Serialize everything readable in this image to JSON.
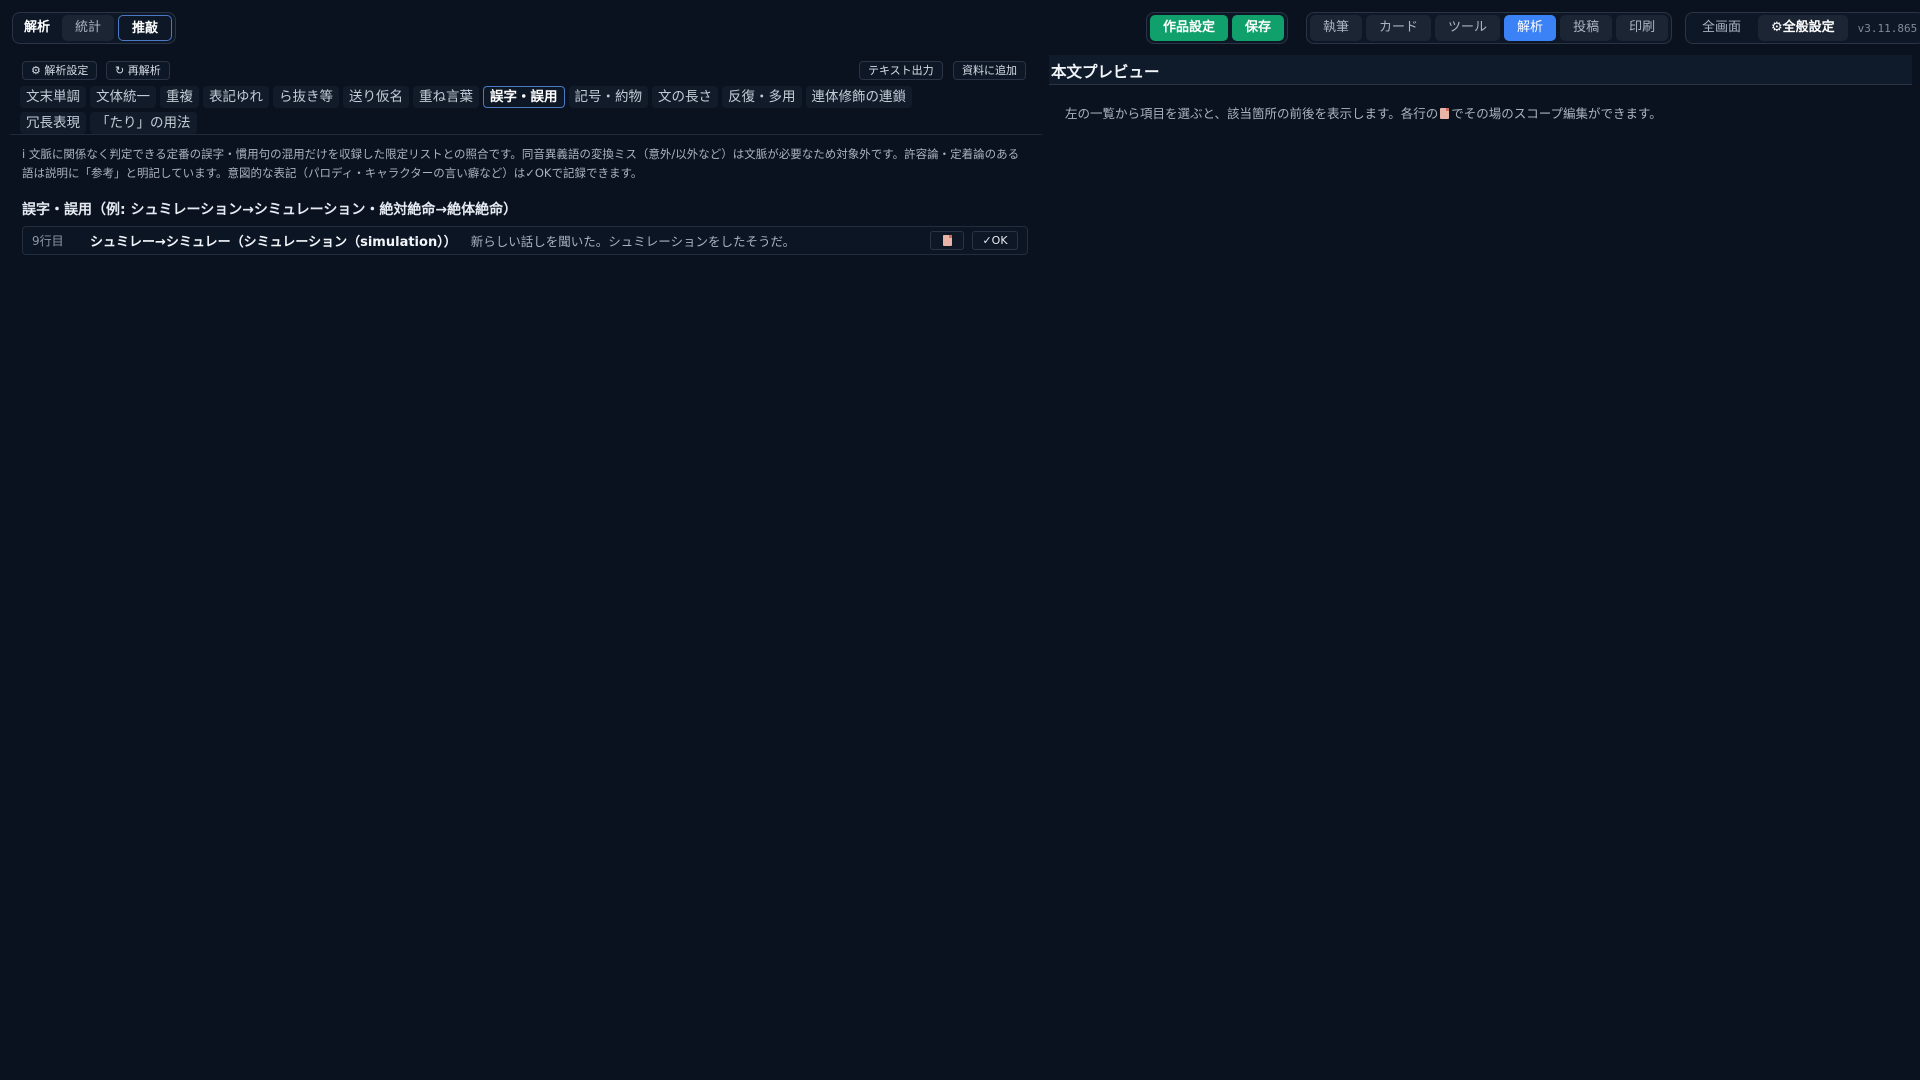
{
  "top_left_tabs": {
    "analysis": "解析",
    "stats": "統計",
    "suggest": "推敲"
  },
  "work_group": {
    "settings": "作品設定",
    "save": "保存"
  },
  "mode_tabs": [
    "執筆",
    "カード",
    "ツール",
    "解析",
    "投稿",
    "印刷"
  ],
  "window_group": {
    "fullscreen": "全画面",
    "global_settings": "⚙全般設定",
    "version": "v3.11.865"
  },
  "toolbar": {
    "analysis_settings": "⚙ 解析設定",
    "reanalyze": "↻ 再解析",
    "text_export": "テキスト出力",
    "add_to_materials": "資料に追加"
  },
  "categories_row1": [
    "文末単調",
    "文体統一",
    "重複",
    "表記ゆれ",
    "ら抜き等",
    "送り仮名",
    "重ね言葉",
    "誤字・誤用",
    "記号・約物",
    "文の長さ",
    "反復・多用",
    "連体修飾の連鎖"
  ],
  "categories_row2": [
    "冗長表現",
    "「たり」の用法"
  ],
  "active_category": "誤字・誤用",
  "info_note": "ⅰ 文脈に関係なく判定できる定番の誤字・慣用句の混用だけを収録した限定リストとの照合です。同音異義語の変換ミス（意外/以外など）は文脈が必要なため対象外です。許容論・定着論のある語は説明に「参考」と明記しています。意図的な表記（パロディ・キャラクターの言い癖など）は✓OKで記録できます。",
  "section_title": "誤字・誤用（例: シュミレーション→シミュレーション・絶対絶命→絶体絶命）",
  "results": [
    {
      "line": "9行目",
      "word": "シュミレー→シミュレー（シミュレーション（simulation））",
      "context": "新らしい話しを聞いた。シュミレーションをしたそうだ。",
      "ok_label": "✓OK",
      "doc_icon": "document-icon"
    }
  ],
  "preview": {
    "title": "本文プレビュー",
    "text_before": "左の一覧から項目を選ぶと、該当箇所の前後を表示します。各行の",
    "text_after": "でその場のスコープ編集ができます。",
    "icon": "document-icon"
  },
  "colors": {
    "background": "#0a1220",
    "accent_blue": "#3b82f6",
    "accent_green": "#10a06b",
    "border": "#2a3445"
  }
}
